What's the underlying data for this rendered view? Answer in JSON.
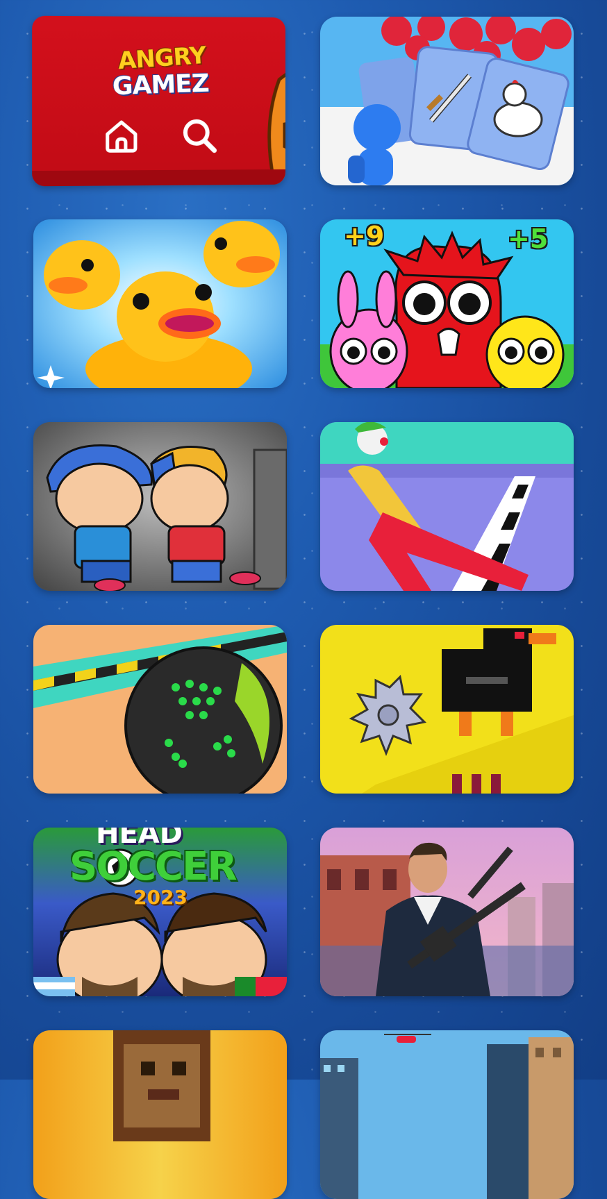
{
  "header": {
    "logo_line1": "ANGRY",
    "logo_line2": "GAMEZ",
    "home_icon": "home-icon",
    "search_icon": "search-icon"
  },
  "tiles": [
    {
      "slot": "card-army-swords",
      "art": "runner with sword and chicken cards"
    },
    {
      "slot": "card-ducks",
      "art": "rubber ducks"
    },
    {
      "slot": "card-sprunki",
      "art": "cartoon characters",
      "badges": [
        "+9",
        "+5"
      ]
    },
    {
      "slot": "card-kids-fight",
      "art": "two boys fighting"
    },
    {
      "slot": "card-clown-run",
      "art": "clown walking to finish line"
    },
    {
      "slot": "card-ball-roll",
      "art": "rolling ball on track"
    },
    {
      "slot": "card-saw-bird",
      "art": "pixel saw and black bird"
    },
    {
      "slot": "card-head-soccer",
      "title": [
        "HEAD",
        "SOCCER",
        "2023"
      ]
    },
    {
      "slot": "card-gta",
      "art": "man with rifle"
    },
    {
      "slot": "card-pixel-block",
      "art": "pixel character"
    },
    {
      "slot": "card-city-heli",
      "art": "city with helicopter"
    }
  ],
  "colors": {
    "background": "#1e5bb0",
    "header_red": "#d3101c",
    "logo_yellow": "#ffcf1f"
  }
}
